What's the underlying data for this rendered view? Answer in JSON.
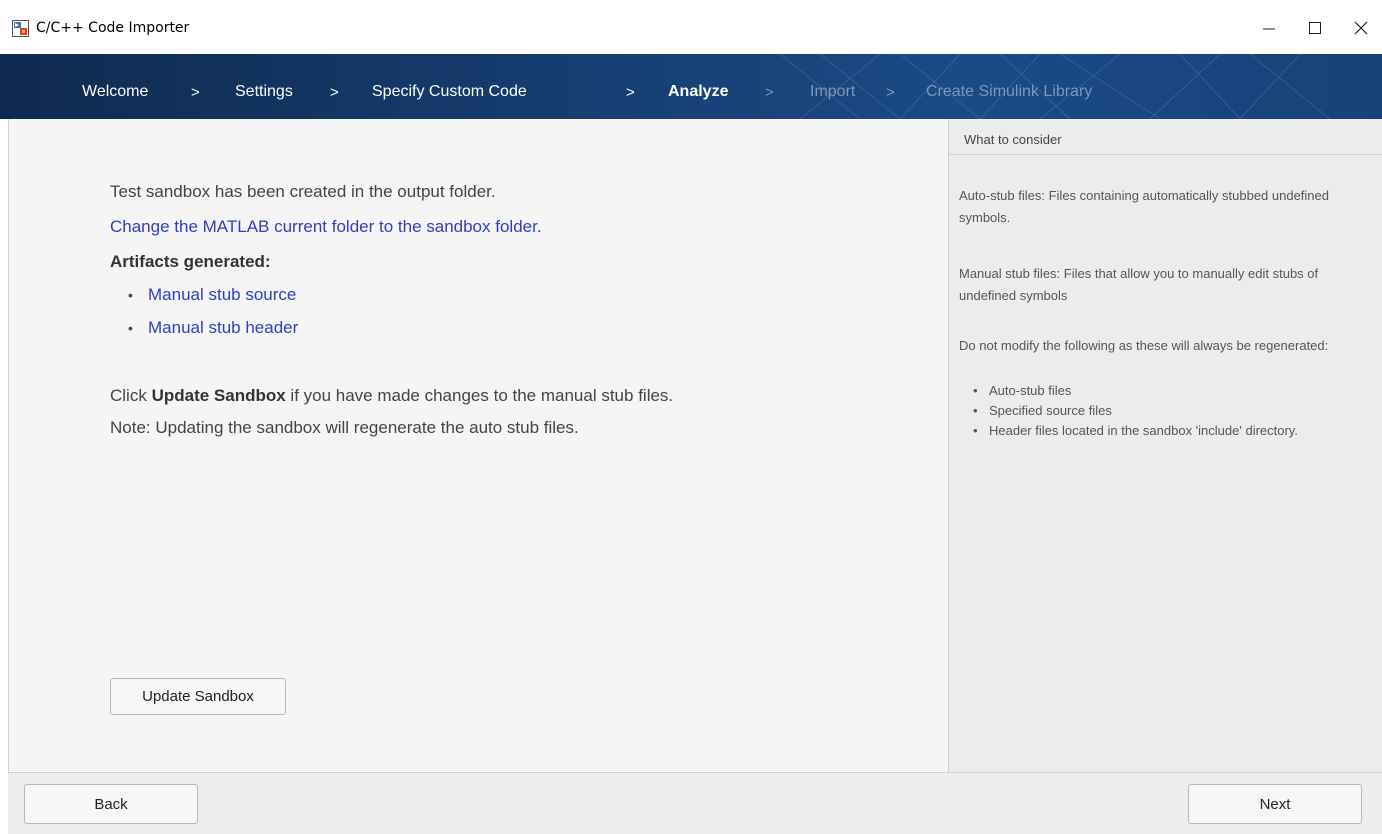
{
  "window": {
    "title": "C/C++ Code Importer"
  },
  "steps": [
    {
      "label": "Welcome",
      "state": "done"
    },
    {
      "label": "Settings",
      "state": "done"
    },
    {
      "label": "Specify Custom Code",
      "state": "done"
    },
    {
      "label": "Analyze",
      "state": "active"
    },
    {
      "label": "Import",
      "state": "disabled"
    },
    {
      "label": "Create Simulink Library",
      "state": "disabled"
    }
  ],
  "separator": ">",
  "main": {
    "line1": "Test sandbox has been created in the output folder.",
    "change_folder_link": "Change the MATLAB current folder to the sandbox folder.",
    "artifacts_heading": "Artifacts generated:",
    "artifacts": [
      "Manual stub source",
      "Manual stub header"
    ],
    "update_pre": "Click ",
    "update_bold": "Update Sandbox",
    "update_post": " if you have made changes to the manual stub files.",
    "note": "Note: Updating the sandbox will regenerate the auto stub files.",
    "update_button": "Update Sandbox"
  },
  "side": {
    "header": "What to consider",
    "para1": "Auto-stub files: Files containing automatically stubbed undefined symbols.",
    "para2": "Manual stub files: Files that allow you to manually edit stubs of undefined symbols",
    "para3": "Do not modify the following as these will always be regenerated:",
    "items": [
      "Auto-stub files",
      "Specified source files",
      "Header files located in the sandbox 'include' directory."
    ]
  },
  "footer": {
    "back": "Back",
    "next": "Next"
  },
  "colors": {
    "link": "#2f3fbf",
    "banner": "#163d70",
    "disabled_step": "#7f97b6"
  }
}
